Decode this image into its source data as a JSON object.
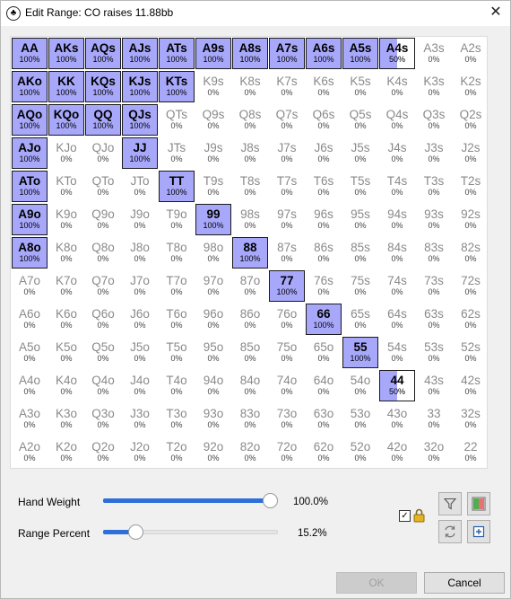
{
  "window": {
    "title": "Edit Range: CO raises 11.88bb",
    "app_icon": "♣",
    "close_glyph": "✕"
  },
  "grid": {
    "ranks": [
      "A",
      "K",
      "Q",
      "J",
      "T",
      "9",
      "8",
      "7",
      "6",
      "5",
      "4",
      "3",
      "2"
    ],
    "highlight_color": "#a8a8fb",
    "cells": [
      [
        "AA",
        "100%",
        "AKs",
        "100%",
        "AQs",
        "100%",
        "AJs",
        "100%",
        "ATs",
        "100%",
        "A9s",
        "100%",
        "A8s",
        "100%",
        "A7s",
        "100%",
        "A6s",
        "100%",
        "A5s",
        "100%",
        "A4s",
        "50%",
        "A3s",
        "0%",
        "A2s",
        "0%"
      ],
      [
        "AKo",
        "100%",
        "KK",
        "100%",
        "KQs",
        "100%",
        "KJs",
        "100%",
        "KTs",
        "100%",
        "K9s",
        "0%",
        "K8s",
        "0%",
        "K7s",
        "0%",
        "K6s",
        "0%",
        "K5s",
        "0%",
        "K4s",
        "0%",
        "K3s",
        "0%",
        "K2s",
        "0%"
      ],
      [
        "AQo",
        "100%",
        "KQo",
        "100%",
        "QQ",
        "100%",
        "QJs",
        "100%",
        "QTs",
        "0%",
        "Q9s",
        "0%",
        "Q8s",
        "0%",
        "Q7s",
        "0%",
        "Q6s",
        "0%",
        "Q5s",
        "0%",
        "Q4s",
        "0%",
        "Q3s",
        "0%",
        "Q2s",
        "0%"
      ],
      [
        "AJo",
        "100%",
        "KJo",
        "0%",
        "QJo",
        "0%",
        "JJ",
        "100%",
        "JTs",
        "0%",
        "J9s",
        "0%",
        "J8s",
        "0%",
        "J7s",
        "0%",
        "J6s",
        "0%",
        "J5s",
        "0%",
        "J4s",
        "0%",
        "J3s",
        "0%",
        "J2s",
        "0%"
      ],
      [
        "ATo",
        "100%",
        "KTo",
        "0%",
        "QTo",
        "0%",
        "JTo",
        "0%",
        "TT",
        "100%",
        "T9s",
        "0%",
        "T8s",
        "0%",
        "T7s",
        "0%",
        "T6s",
        "0%",
        "T5s",
        "0%",
        "T4s",
        "0%",
        "T3s",
        "0%",
        "T2s",
        "0%"
      ],
      [
        "A9o",
        "100%",
        "K9o",
        "0%",
        "Q9o",
        "0%",
        "J9o",
        "0%",
        "T9o",
        "0%",
        "99",
        "100%",
        "98s",
        "0%",
        "97s",
        "0%",
        "96s",
        "0%",
        "95s",
        "0%",
        "94s",
        "0%",
        "93s",
        "0%",
        "92s",
        "0%"
      ],
      [
        "A8o",
        "100%",
        "K8o",
        "0%",
        "Q8o",
        "0%",
        "J8o",
        "0%",
        "T8o",
        "0%",
        "98o",
        "0%",
        "88",
        "100%",
        "87s",
        "0%",
        "86s",
        "0%",
        "85s",
        "0%",
        "84s",
        "0%",
        "83s",
        "0%",
        "82s",
        "0%"
      ],
      [
        "A7o",
        "0%",
        "K7o",
        "0%",
        "Q7o",
        "0%",
        "J7o",
        "0%",
        "T7o",
        "0%",
        "97o",
        "0%",
        "87o",
        "0%",
        "77",
        "100%",
        "76s",
        "0%",
        "75s",
        "0%",
        "74s",
        "0%",
        "73s",
        "0%",
        "72s",
        "0%"
      ],
      [
        "A6o",
        "0%",
        "K6o",
        "0%",
        "Q6o",
        "0%",
        "J6o",
        "0%",
        "T6o",
        "0%",
        "96o",
        "0%",
        "86o",
        "0%",
        "76o",
        "0%",
        "66",
        "100%",
        "65s",
        "0%",
        "64s",
        "0%",
        "63s",
        "0%",
        "62s",
        "0%"
      ],
      [
        "A5o",
        "0%",
        "K5o",
        "0%",
        "Q5o",
        "0%",
        "J5o",
        "0%",
        "T5o",
        "0%",
        "95o",
        "0%",
        "85o",
        "0%",
        "75o",
        "0%",
        "65o",
        "0%",
        "55",
        "100%",
        "54s",
        "0%",
        "53s",
        "0%",
        "52s",
        "0%"
      ],
      [
        "A4o",
        "0%",
        "K4o",
        "0%",
        "Q4o",
        "0%",
        "J4o",
        "0%",
        "T4o",
        "0%",
        "94o",
        "0%",
        "84o",
        "0%",
        "74o",
        "0%",
        "64o",
        "0%",
        "54o",
        "0%",
        "44",
        "50%",
        "43s",
        "0%",
        "42s",
        "0%"
      ],
      [
        "A3o",
        "0%",
        "K3o",
        "0%",
        "Q3o",
        "0%",
        "J3o",
        "0%",
        "T3o",
        "0%",
        "93o",
        "0%",
        "83o",
        "0%",
        "73o",
        "0%",
        "63o",
        "0%",
        "53o",
        "0%",
        "43o",
        "0%",
        "33",
        "0%",
        "32s",
        "0%"
      ],
      [
        "A2o",
        "0%",
        "K2o",
        "0%",
        "Q2o",
        "0%",
        "J2o",
        "0%",
        "T2o",
        "0%",
        "92o",
        "0%",
        "82o",
        "0%",
        "72o",
        "0%",
        "62o",
        "0%",
        "52o",
        "0%",
        "42o",
        "0%",
        "32o",
        "0%",
        "22",
        "0%"
      ]
    ]
  },
  "controls": {
    "hand_weight": {
      "label": "Hand Weight",
      "value_text": "100.0%",
      "value": 1.0
    },
    "range_percent": {
      "label": "Range Percent",
      "value_text": "15.2%",
      "value": 0.152
    },
    "lock_checked": true,
    "icons": {
      "filter": "filter-icon",
      "color": "color-swatch-icon",
      "sync": "sync-icon",
      "add": "plus-box-icon",
      "lock": "lock-icon"
    }
  },
  "buttons": {
    "ok": "OK",
    "cancel": "Cancel"
  }
}
